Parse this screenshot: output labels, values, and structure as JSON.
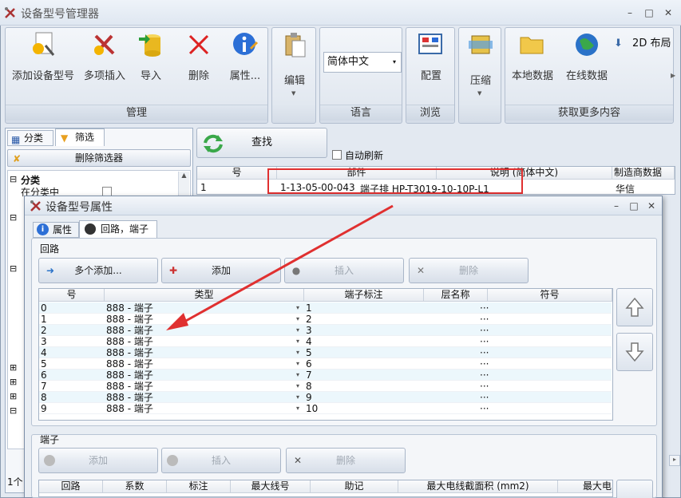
{
  "app": {
    "title": "设备型号管理器"
  },
  "ribbon": {
    "manage": {
      "label": "管理",
      "add": "添加设备型号",
      "multi_insert": "多项插入",
      "import": "导入",
      "delete": "删除",
      "properties": "属性..."
    },
    "edit": {
      "label": "编辑"
    },
    "language": {
      "label": "语言",
      "value": "简体中文"
    },
    "browse": {
      "label": "浏览",
      "config": "配置"
    },
    "compress": {
      "label": "压缩"
    },
    "more": {
      "label": "获取更多内容",
      "local": "本地数据",
      "online": "在线数据",
      "layout": "2D 布局"
    }
  },
  "left": {
    "tab_category": "分类",
    "tab_filter": "筛选",
    "delete_filter": "删除筛选器",
    "tree_root": "分类",
    "tree_item1": "在分类中"
  },
  "search": {
    "find": "查找",
    "auto_refresh": "自动刷新"
  },
  "main_table": {
    "headers": [
      "号",
      "部件",
      "说明 (简体中文)",
      "制造商数据"
    ],
    "row": {
      "no": "1",
      "part": "1-13-05-00-043",
      "desc": "端子排 HP-T3019-10-10P-L1",
      "mfr": "华信"
    }
  },
  "dialog": {
    "title": "设备型号属性",
    "tab_props": "属性",
    "tab_circuit": "回路，端子",
    "circuit_section": "回路",
    "btn_multi_add": "多个添加...",
    "btn_add": "添加",
    "btn_insert": "插入",
    "btn_delete": "删除",
    "headers": [
      "号",
      "类型",
      "端子标注",
      "层名称",
      "符号"
    ],
    "rows": [
      {
        "no": "0",
        "type": "888 - 端子",
        "label": "1",
        "layer": "···"
      },
      {
        "no": "1",
        "type": "888 - 端子",
        "label": "2",
        "layer": "···"
      },
      {
        "no": "2",
        "type": "888 - 端子",
        "label": "3",
        "layer": "···"
      },
      {
        "no": "3",
        "type": "888 - 端子",
        "label": "4",
        "layer": "···"
      },
      {
        "no": "4",
        "type": "888 - 端子",
        "label": "5",
        "layer": "···"
      },
      {
        "no": "5",
        "type": "888 - 端子",
        "label": "6",
        "layer": "···"
      },
      {
        "no": "6",
        "type": "888 - 端子",
        "label": "7",
        "layer": "···"
      },
      {
        "no": "7",
        "type": "888 - 端子",
        "label": "8",
        "layer": "···"
      },
      {
        "no": "8",
        "type": "888 - 端子",
        "label": "9",
        "layer": "···"
      },
      {
        "no": "9",
        "type": "888 - 端子",
        "label": "10",
        "layer": "···"
      }
    ],
    "terminal_section": "端子",
    "t_add": "添加",
    "t_insert": "插入",
    "t_delete": "删除",
    "t_headers": [
      "回路",
      "系数",
      "标注",
      "最大线号",
      "助记",
      "最大电线截面积 (mm2)",
      "最大电"
    ]
  },
  "status": {
    "text": "1个"
  },
  "colors": {
    "accent": "#e03030",
    "select_row": "#ecf7fc"
  }
}
